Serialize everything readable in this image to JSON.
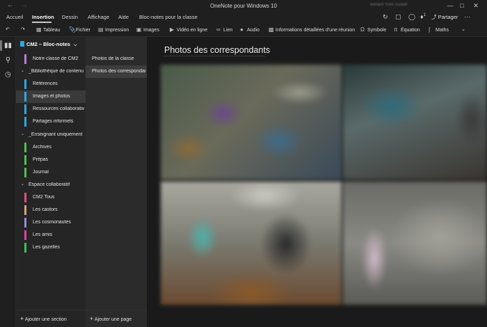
{
  "window": {
    "title": "OneNote pour Windows 10",
    "back_glyph": "←",
    "forward_glyph": "→",
    "user_label": "Bénard Yves Gudatt"
  },
  "menu": {
    "items": [
      "Accueil",
      "Insertion",
      "Dessin",
      "Affichage",
      "Aide",
      "Bloc-notes pour la classe"
    ],
    "active_index": 1,
    "share_label": "Partager",
    "notification_count": "1"
  },
  "ribbon": {
    "items": [
      {
        "label": "Tableau",
        "icon": "table-icon"
      },
      {
        "label": "Fichier",
        "icon": "paperclip-icon"
      },
      {
        "label": "Impression",
        "icon": "printout-icon"
      },
      {
        "label": "Images",
        "icon": "picture-icon"
      },
      {
        "label": "Vidéo en ligne",
        "icon": "video-icon"
      },
      {
        "label": "Lien",
        "icon": "link-icon"
      },
      {
        "label": "Audio",
        "icon": "microphone-icon"
      },
      {
        "label": "Informations détaillées d'une réunion",
        "icon": "meeting-icon"
      },
      {
        "label": "Symbole",
        "icon": "omega-icon"
      },
      {
        "label": "Équation",
        "icon": "pi-icon"
      },
      {
        "label": "Maths",
        "icon": "math-icon"
      }
    ]
  },
  "sections_pane": {
    "notebook_name": "CM2 – Bloc-notes",
    "add_section_label": "Ajouter une section",
    "entries": [
      {
        "kind": "section",
        "label": "Notre classe de CM2",
        "color": "#b97fd9",
        "selected": false
      },
      {
        "kind": "group",
        "label": "_Bibliothèque de contenu"
      },
      {
        "kind": "section",
        "label": "Références",
        "color": "#2ea8e6",
        "selected": false
      },
      {
        "kind": "section",
        "label": "Images et photos",
        "color": "#2ea8e6",
        "selected": true
      },
      {
        "kind": "section",
        "label": "Ressources collaboratives",
        "color": "#2ea8e6",
        "selected": false
      },
      {
        "kind": "section",
        "label": "Partages informels",
        "color": "#2ea8e6",
        "selected": false
      },
      {
        "kind": "group",
        "label": "_Enseignant uniquement"
      },
      {
        "kind": "section",
        "label": "Archives",
        "color": "#4cc24c",
        "selected": false
      },
      {
        "kind": "section",
        "label": "Prépas",
        "color": "#4cc24c",
        "selected": false
      },
      {
        "kind": "section",
        "label": "Journal",
        "color": "#4cc24c",
        "selected": false
      },
      {
        "kind": "group",
        "label": "Espace collaboratif"
      },
      {
        "kind": "section",
        "label": "CM2 Tous",
        "color": "#e0507a",
        "selected": false
      },
      {
        "kind": "section",
        "label": "Les castors",
        "color": "#d6a37a",
        "selected": false
      },
      {
        "kind": "section",
        "label": "Les cosmonautes",
        "color": "#9a8bd4",
        "selected": false
      },
      {
        "kind": "section",
        "label": "Les amis",
        "color": "#e03fa6",
        "selected": false
      },
      {
        "kind": "section",
        "label": "Les gazelles",
        "color": "#3fbf5a",
        "selected": false
      }
    ]
  },
  "pages_pane": {
    "add_page_label": "Ajouter une page",
    "pages": [
      {
        "label": "Photos de la classe",
        "selected": false
      },
      {
        "label": "Photos des correspondants",
        "selected": true
      }
    ]
  },
  "canvas": {
    "page_title": "Photos des correspondants"
  },
  "colors": {
    "background": "#1f1f1f",
    "sections_pane": "#252525",
    "pages_pane": "#2b2b2b",
    "canvas": "#1a1a1a"
  }
}
